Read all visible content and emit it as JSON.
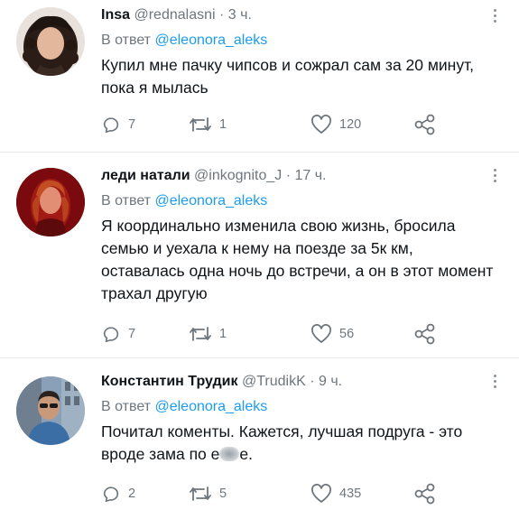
{
  "tweets": [
    {
      "name": "Insa",
      "handle": "@rednalasni",
      "separator": "·",
      "time": "3 ч.",
      "reply_prefix": "В ответ",
      "reply_to": "@eleonora_aleks",
      "text": "Купил мне пачку чипсов и сожрал сам за 20 минут, пока я мылась",
      "text_blurred_suffix": "",
      "replies": "7",
      "retweets": "1",
      "likes": "120"
    },
    {
      "name": "леди натали",
      "handle": "@inkognito_J",
      "separator": "·",
      "time": "17 ч.",
      "reply_prefix": "В ответ",
      "reply_to": "@eleonora_aleks",
      "text": "Я координально изменила свою жизнь, бросила семью и уехала к нему на поезде за 5к км, оставалась одна ночь до встречи, а он в этот момент трахал другую",
      "text_blurred_suffix": "",
      "replies": "7",
      "retweets": "1",
      "likes": "56"
    },
    {
      "name": "Константин Трудик",
      "handle": "@TrudikK",
      "separator": "·",
      "time": "9 ч.",
      "reply_prefix": "В ответ",
      "reply_to": "@eleonora_aleks",
      "text": "Почитал коменты. Кажется, лучшая подруга - это вроде зама по е",
      "text_blurred_suffix": "е.",
      "replies": "2",
      "retweets": "5",
      "likes": "435"
    }
  ],
  "colors": {
    "accent": "#1d9bf0",
    "muted": "#6e767d",
    "text": "#0f1419",
    "divider": "#e6e8ea"
  },
  "icons": [
    "reply-icon",
    "retweet-icon",
    "like-icon",
    "share-icon",
    "more-options-icon"
  ]
}
